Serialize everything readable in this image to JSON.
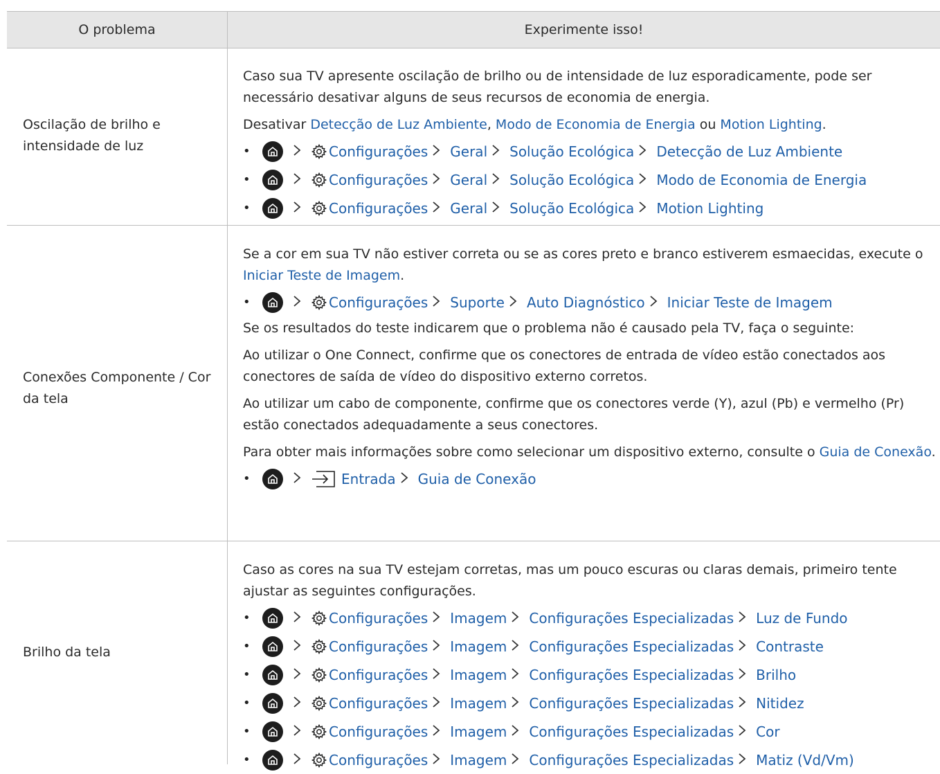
{
  "header": {
    "col1": "O problema",
    "col2": "Experimente isso!"
  },
  "rows": [
    {
      "problem": "Oscilação de brilho e intensidade de luz",
      "intro": "Caso sua TV apresente oscilação de brilho ou de intensidade de luz esporadicamente, pode ser necessário desativar alguns de seus recursos de economia de energia.",
      "disable_prefix": "Desativar",
      "disable_item1": "Detecção de Luz Ambiente",
      "comma": ",",
      "disable_item2": "Modo de Economia de Energia",
      "disable_or": "ou",
      "disable_item3": "Motion Lighting",
      "period": ".",
      "paths": [
        [
          "Configurações",
          "Geral",
          "Solução Ecológica",
          "Detecção de Luz Ambiente"
        ],
        [
          "Configurações",
          "Geral",
          "Solução Ecológica",
          "Modo de Economia de Energia"
        ],
        [
          "Configurações",
          "Geral",
          "Solução Ecológica",
          "Motion Lighting"
        ]
      ]
    },
    {
      "problem": "Conexões Componente / Cor da tela",
      "p1_text": "Se a cor em sua TV não estiver correta ou se as cores preto e branco estiverem esmaecidas, execute o",
      "p1_link": "Iniciar Teste de Imagem",
      "p1_end": ".",
      "path1": [
        "Configurações",
        "Suporte",
        "Auto Diagnóstico",
        "Iniciar Teste de Imagem"
      ],
      "p2": "Se os resultados do teste indicarem que o problema não é causado pela TV, faça o seguinte:",
      "p3": "Ao utilizar o One Connect, confirme que os conectores de entrada de vídeo estão conectados aos conectores de saída de vídeo do dispositivo externo corretos.",
      "p4": "Ao utilizar um cabo de componente, confirme que os conectores verde (Y), azul (Pb) e vermelho (Pr) estão conectados adequadamente a seus conectores.",
      "p5_text": "Para obter mais informações sobre como selecionar um dispositivo externo, consulte o",
      "p5_link": "Guia de Conexão",
      "p5_end": ".",
      "path2": [
        "Entrada",
        "Guia de Conexão"
      ]
    },
    {
      "problem": "Brilho da tela",
      "intro": "Caso as cores na sua TV estejam corretas, mas um pouco escuras ou claras demais, primeiro tente ajustar as seguintes configurações.",
      "paths": [
        [
          "Configurações",
          "Imagem",
          "Configurações Especializadas",
          "Luz de Fundo"
        ],
        [
          "Configurações",
          "Imagem",
          "Configurações Especializadas",
          "Contraste"
        ],
        [
          "Configurações",
          "Imagem",
          "Configurações Especializadas",
          "Brilho"
        ],
        [
          "Configurações",
          "Imagem",
          "Configurações Especializadas",
          "Nitidez"
        ],
        [
          "Configurações",
          "Imagem",
          "Configurações Especializadas",
          "Cor"
        ],
        [
          "Configurações",
          "Imagem",
          "Configurações Especializadas",
          "Matiz (Vd/Vm)"
        ]
      ]
    }
  ],
  "icons": {
    "home": "home-icon",
    "settings": "gear-icon",
    "source": "source-input-icon",
    "separator": "chevron-right-icon"
  },
  "colors": {
    "link": "#1f5fa8",
    "header_bg": "#e6e6e6",
    "border": "#bdbdbd"
  }
}
